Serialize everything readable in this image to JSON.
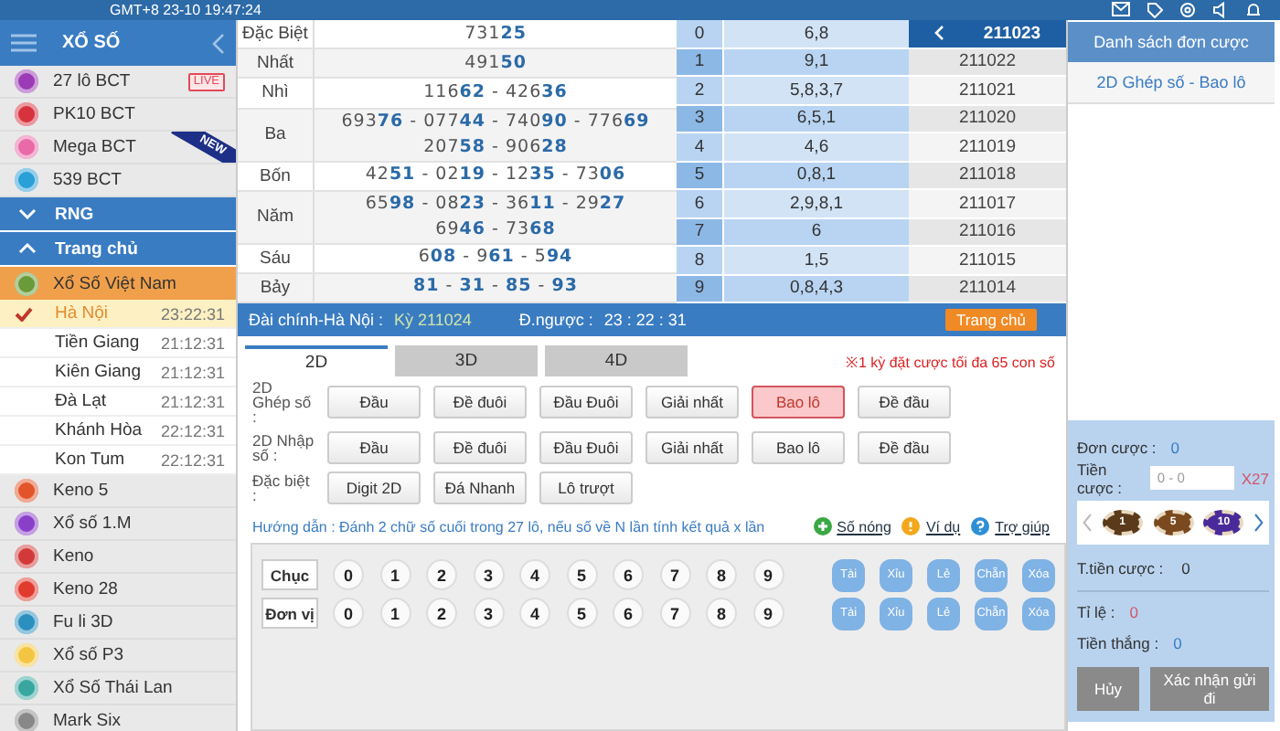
{
  "top_bar": {
    "clock": "GMT+8 23-10 19:47:24"
  },
  "sidebar": {
    "title": "XỔ SỐ",
    "items": [
      {
        "kind": "game",
        "label": "27 lô BCT",
        "color": "#9b3bb5",
        "badge": {
          "kind": "live",
          "text": "LIVE"
        }
      },
      {
        "kind": "game",
        "label": "PK10 BCT",
        "color": "#d7333f"
      },
      {
        "kind": "game",
        "label": "Mega BCT",
        "color": "#e86aa8",
        "badge": {
          "kind": "new",
          "text": "NEW"
        }
      },
      {
        "kind": "game",
        "label": "539 BCT",
        "color": "#2a9fd8"
      },
      {
        "kind": "section",
        "label": "RNG",
        "expanded": false
      },
      {
        "kind": "section",
        "label": "Trang chủ",
        "expanded": true
      },
      {
        "kind": "group",
        "label": "Xổ Số Việt Nam",
        "color": "#6a9a3a",
        "children": [
          {
            "label": "Hà Nội",
            "time": "23:22:31",
            "selected": true
          },
          {
            "label": "Tiền Giang",
            "time": "21:12:31",
            "selected": false
          },
          {
            "label": "Kiên Giang",
            "time": "21:12:31",
            "selected": false
          },
          {
            "label": "Đà Lạt",
            "time": "21:12:31",
            "selected": false
          },
          {
            "label": "Khánh Hòa",
            "time": "22:12:31",
            "selected": false
          },
          {
            "label": "Kon Tum",
            "time": "22:12:31",
            "selected": false
          }
        ]
      },
      {
        "kind": "game",
        "label": "Keno 5",
        "color": "#e2552b"
      },
      {
        "kind": "game",
        "label": "Xổ số 1.M",
        "color": "#8a3fc9"
      },
      {
        "kind": "game",
        "label": "Keno",
        "color": "#d23a3a"
      },
      {
        "kind": "game",
        "label": "Keno 28",
        "color": "#e03b2e"
      },
      {
        "kind": "game",
        "label": "Fu li 3D",
        "color": "#2b8fbf"
      },
      {
        "kind": "game",
        "label": "Xổ số P3",
        "color": "#f4c542"
      },
      {
        "kind": "game",
        "label": "Xổ Số Thái Lan",
        "color": "#3aa6a0"
      },
      {
        "kind": "game",
        "label": "Mark Six",
        "color": "#888888"
      }
    ]
  },
  "results": [
    {
      "prize": "Đặc Biệt",
      "lines": [
        "73125"
      ]
    },
    {
      "prize": "Nhất",
      "lines": [
        "49150"
      ]
    },
    {
      "prize": "Nhì",
      "lines": [
        "11662 - 42636"
      ]
    },
    {
      "prize": "Ba",
      "lines": [
        "69376 - 07744 - 74090 - 77669",
        "20758 - 90628"
      ]
    },
    {
      "prize": "Bốn",
      "lines": [
        "4251 - 0219 - 1235 - 7306"
      ]
    },
    {
      "prize": "Năm",
      "lines": [
        "6598 - 0823 - 3611 - 2927",
        "6946 - 7368"
      ]
    },
    {
      "prize": "Sáu",
      "lines": [
        "608 - 961 - 594"
      ]
    },
    {
      "prize": "Bảy",
      "lines": [
        "81 - 31 - 85 - 93"
      ]
    }
  ],
  "head_tail": [
    {
      "digit": "0",
      "values": "6,8"
    },
    {
      "digit": "1",
      "values": "9,1"
    },
    {
      "digit": "2",
      "values": "5,8,3,7"
    },
    {
      "digit": "3",
      "values": "6,5,1"
    },
    {
      "digit": "4",
      "values": "4,6"
    },
    {
      "digit": "5",
      "values": "0,8,1"
    },
    {
      "digit": "6",
      "values": "2,9,8,1"
    },
    {
      "digit": "7",
      "values": "6"
    },
    {
      "digit": "8",
      "values": "1,5"
    },
    {
      "digit": "9",
      "values": "0,8,4,3"
    }
  ],
  "periods": {
    "current": "211023",
    "list": [
      "211022",
      "211021",
      "211020",
      "211019",
      "211018",
      "211017",
      "211016",
      "211015",
      "211014"
    ]
  },
  "info_bar": {
    "station": "Đài chính-Hà Nội :",
    "period": "Kỳ 211024",
    "countdown_label": "Đ.ngược :",
    "countdown": "23 : 22 : 31",
    "home_button": "Trang chủ"
  },
  "tabs": [
    {
      "label": "2D",
      "selected": true
    },
    {
      "label": "3D",
      "selected": false
    },
    {
      "label": "4D",
      "selected": false
    }
  ],
  "limit_note": "※1 kỳ đặt cược tối đa 65 con số",
  "bet_groups": [
    {
      "label": "2D Ghép số :",
      "options": [
        {
          "label": "Đầu",
          "selected": false
        },
        {
          "label": "Đề đuôi",
          "selected": false
        },
        {
          "label": "Đầu Đuôi",
          "selected": false
        },
        {
          "label": "Giải nhất",
          "selected": false
        },
        {
          "label": "Bao lô",
          "selected": true
        },
        {
          "label": "Đề đầu",
          "selected": false
        }
      ]
    },
    {
      "label": "2D Nhập số :",
      "options": [
        {
          "label": "Đầu",
          "selected": false
        },
        {
          "label": "Đề đuôi",
          "selected": false
        },
        {
          "label": "Đầu Đuôi",
          "selected": false
        },
        {
          "label": "Giải nhất",
          "selected": false
        },
        {
          "label": "Bao lô",
          "selected": false
        },
        {
          "label": "Đề đầu",
          "selected": false
        }
      ]
    },
    {
      "label": "Đặc biệt :",
      "options": [
        {
          "label": "Digit 2D",
          "selected": false
        },
        {
          "label": "Đá Nhanh",
          "selected": false
        },
        {
          "label": "Lô trượt",
          "selected": false
        }
      ]
    }
  ],
  "guide": {
    "text": "Hướng dẫn : Đánh 2 chữ số cuối trong 27 lô, nếu số về N lần tính kết quả x lần"
  },
  "links": [
    {
      "kind": "hot",
      "label": "Số nóng"
    },
    {
      "kind": "example",
      "label": "Ví dụ"
    },
    {
      "kind": "help",
      "label": "Trợ giúp"
    }
  ],
  "pickers": [
    {
      "label": "Chục",
      "digits": [
        {
          "label": "0",
          "selected": false
        },
        {
          "label": "1",
          "selected": false
        },
        {
          "label": "2",
          "selected": false
        },
        {
          "label": "3",
          "selected": false
        },
        {
          "label": "4",
          "selected": false
        },
        {
          "label": "5",
          "selected": false
        },
        {
          "label": "6",
          "selected": false
        },
        {
          "label": "7",
          "selected": false
        },
        {
          "label": "8",
          "selected": false
        },
        {
          "label": "9",
          "selected": false
        }
      ],
      "quick": [
        "Tài",
        "Xỉu",
        "Lẻ",
        "Chẵn",
        "Xóa"
      ]
    },
    {
      "label": "Đơn vị",
      "digits": [
        {
          "label": "0",
          "selected": false
        },
        {
          "label": "1",
          "selected": false
        },
        {
          "label": "2",
          "selected": false
        },
        {
          "label": "3",
          "selected": false
        },
        {
          "label": "4",
          "selected": false
        },
        {
          "label": "5",
          "selected": false
        },
        {
          "label": "6",
          "selected": false
        },
        {
          "label": "7",
          "selected": false
        },
        {
          "label": "8",
          "selected": false
        },
        {
          "label": "9",
          "selected": false
        }
      ],
      "quick": [
        "Tài",
        "Xỉu",
        "Lẻ",
        "Chẵn",
        "Xóa"
      ]
    }
  ],
  "bet_panel": {
    "title": "Danh sách đơn cược",
    "orders": [
      "2D Ghép số - Bao lô"
    ],
    "order_count_label": "Đơn cược :",
    "order_count": "0",
    "stake_label": "Tiền cược :",
    "stake_placeholder": "0 - 0",
    "multiplier": "X27",
    "chips": [
      {
        "label": "1",
        "color": "#5a3a1a"
      },
      {
        "label": "5",
        "color": "#7a4a1e"
      },
      {
        "label": "10",
        "color": "#4a2a9a"
      }
    ],
    "total_label": "T.tiền cược :",
    "total": "0",
    "odds_label": "Tỉ lệ :",
    "odds": "0",
    "win_label": "Tiền thắng :",
    "win": "0",
    "buttons": [
      {
        "kind": "cancel",
        "label": "Hủy"
      },
      {
        "kind": "confirm",
        "label": "Xác nhận gửi đi"
      }
    ]
  }
}
